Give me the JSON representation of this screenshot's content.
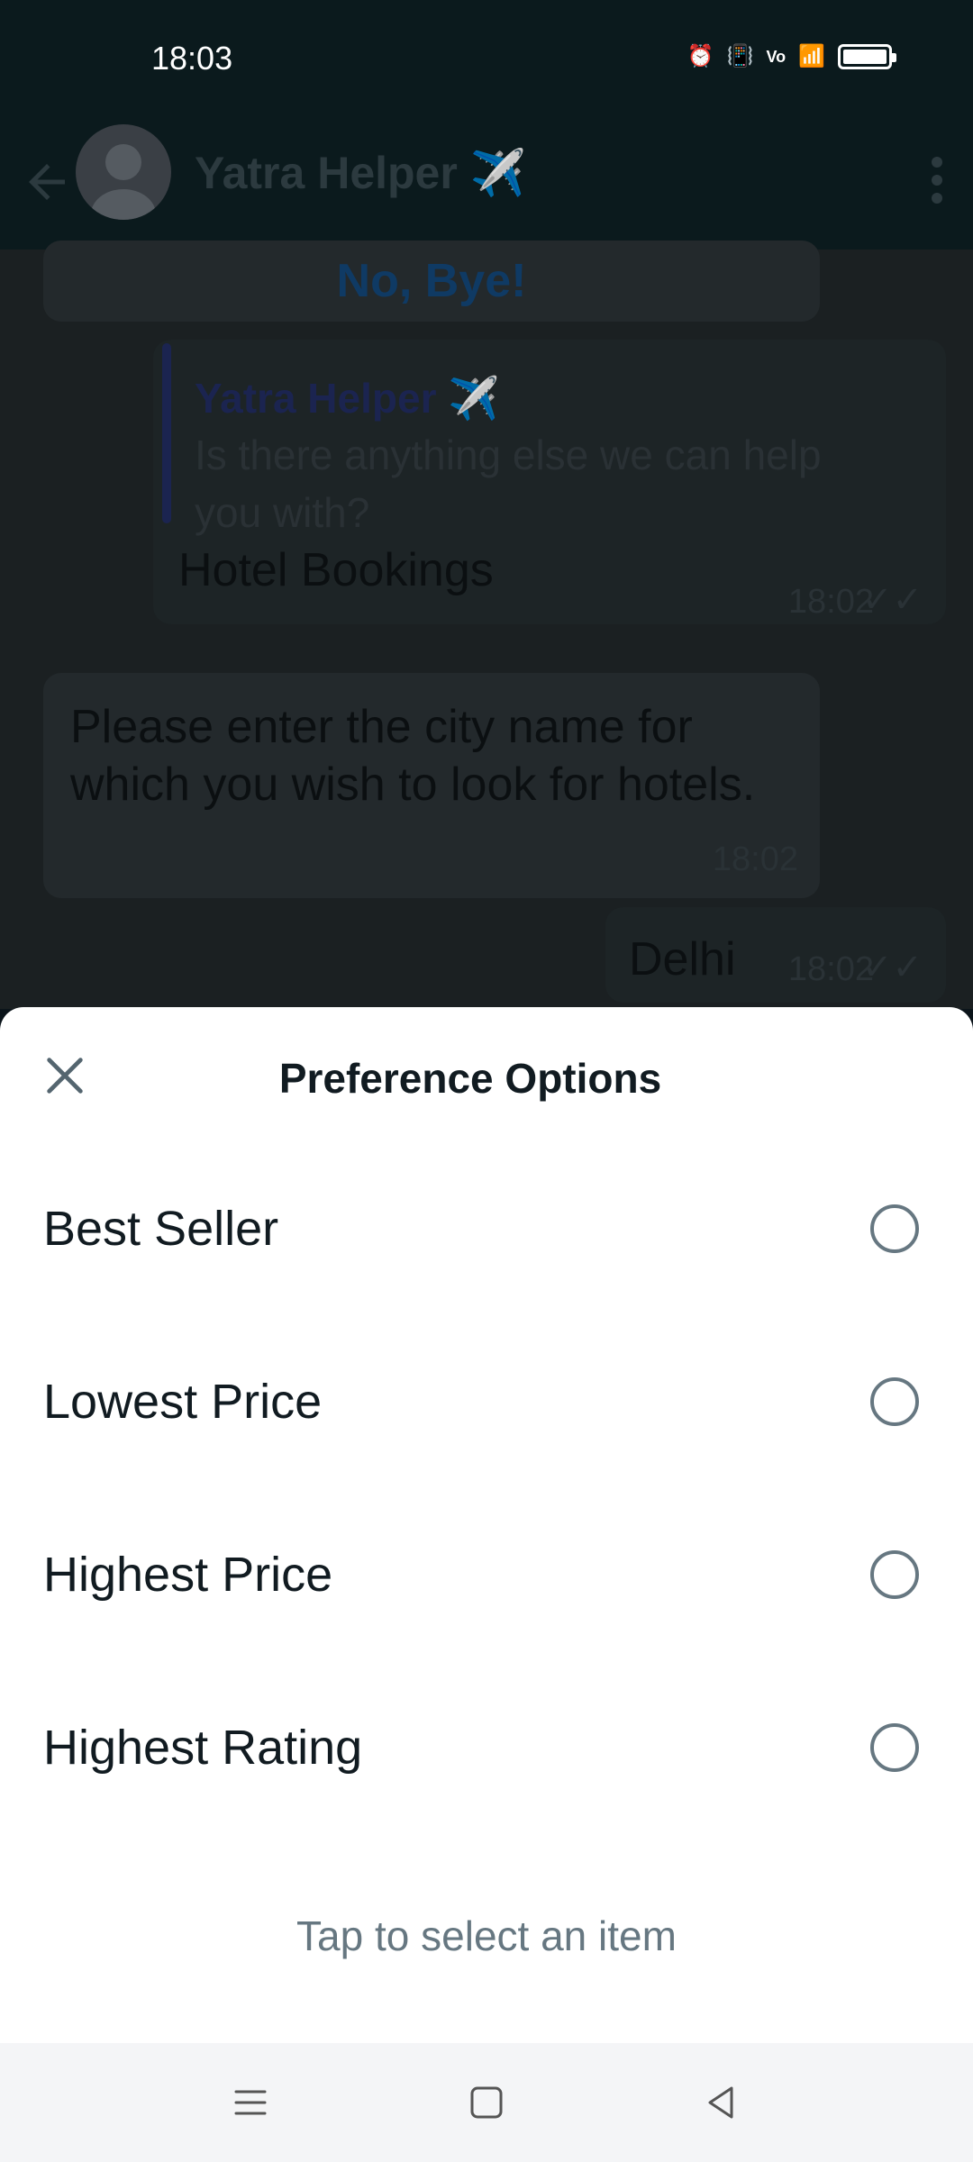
{
  "status": {
    "time": "18:03"
  },
  "header": {
    "title": "Yatra Helper ✈️"
  },
  "chat": {
    "no_bye": "No, Bye!",
    "reply": {
      "quoted_author": "Yatra Helper ✈️",
      "quoted_text": "Is there anything else we can help you with?",
      "text": "Hotel Bookings",
      "time": "18:02"
    },
    "incoming": {
      "text": "Please enter the city name for which you wish to look for hotels.",
      "time": "18:02"
    },
    "outgoing": {
      "text": "Delhi",
      "time": "18:02"
    }
  },
  "sheet": {
    "title": "Preference Options",
    "options": [
      {
        "label": "Best Seller",
        "selected": false
      },
      {
        "label": "Lowest Price",
        "selected": false
      },
      {
        "label": "Highest Price",
        "selected": false
      },
      {
        "label": "Highest Rating",
        "selected": false
      }
    ],
    "hint": "Tap to select an item"
  },
  "icons": {
    "back": "arrow-left-icon",
    "menu": "more-vert-icon",
    "close": "close-icon",
    "nav_menu": "menu-icon",
    "nav_home": "home-icon",
    "nav_back": "back-triangle-icon"
  }
}
